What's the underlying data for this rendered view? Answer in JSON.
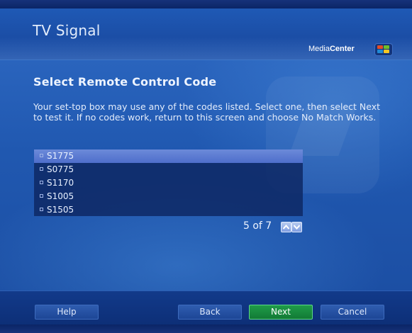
{
  "window": {
    "title": "TV Signal",
    "brand_light": "Media",
    "brand_bold": "Center"
  },
  "page": {
    "heading": "Select Remote Control Code",
    "description": "Your set-top box may use any of the codes listed. Select one, then select Next to test it. If no codes work, return to this screen and choose No Match Works."
  },
  "codes": [
    "S1775",
    "S0775",
    "S1170",
    "S1005",
    "S1505"
  ],
  "selected_code": "S1775",
  "pager": {
    "label": "5 of 7"
  },
  "footer": {
    "help": "Help",
    "back": "Back",
    "next": "Next",
    "cancel": "Cancel"
  },
  "icons": {
    "up": "chevron-up-icon",
    "down": "chevron-down-icon",
    "logo": "windows-flag-icon"
  },
  "colors": {
    "accent": "#1f9c49",
    "selection": "#5b7bd2",
    "background": "#2058b0"
  }
}
